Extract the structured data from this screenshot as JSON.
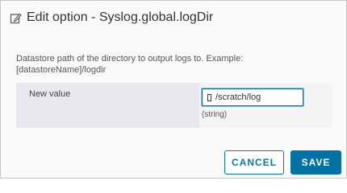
{
  "dialog": {
    "title": "Edit option - Syslog.global.logDir",
    "title_icon": "edit-icon"
  },
  "description": "Datastore path of the directory to output logs to. Example: [datastoreName]/logdir",
  "form": {
    "label": "New value",
    "value": "[] /scratch/log",
    "value_text": "/scratch/log",
    "type_hint": "(string)"
  },
  "buttons": {
    "cancel_label": "CANCEL",
    "save_label": "SAVE"
  },
  "colors": {
    "accent": "#0072a3",
    "secondary_border": "#0079b8",
    "panel_label_bg": "#e8e8ee"
  }
}
